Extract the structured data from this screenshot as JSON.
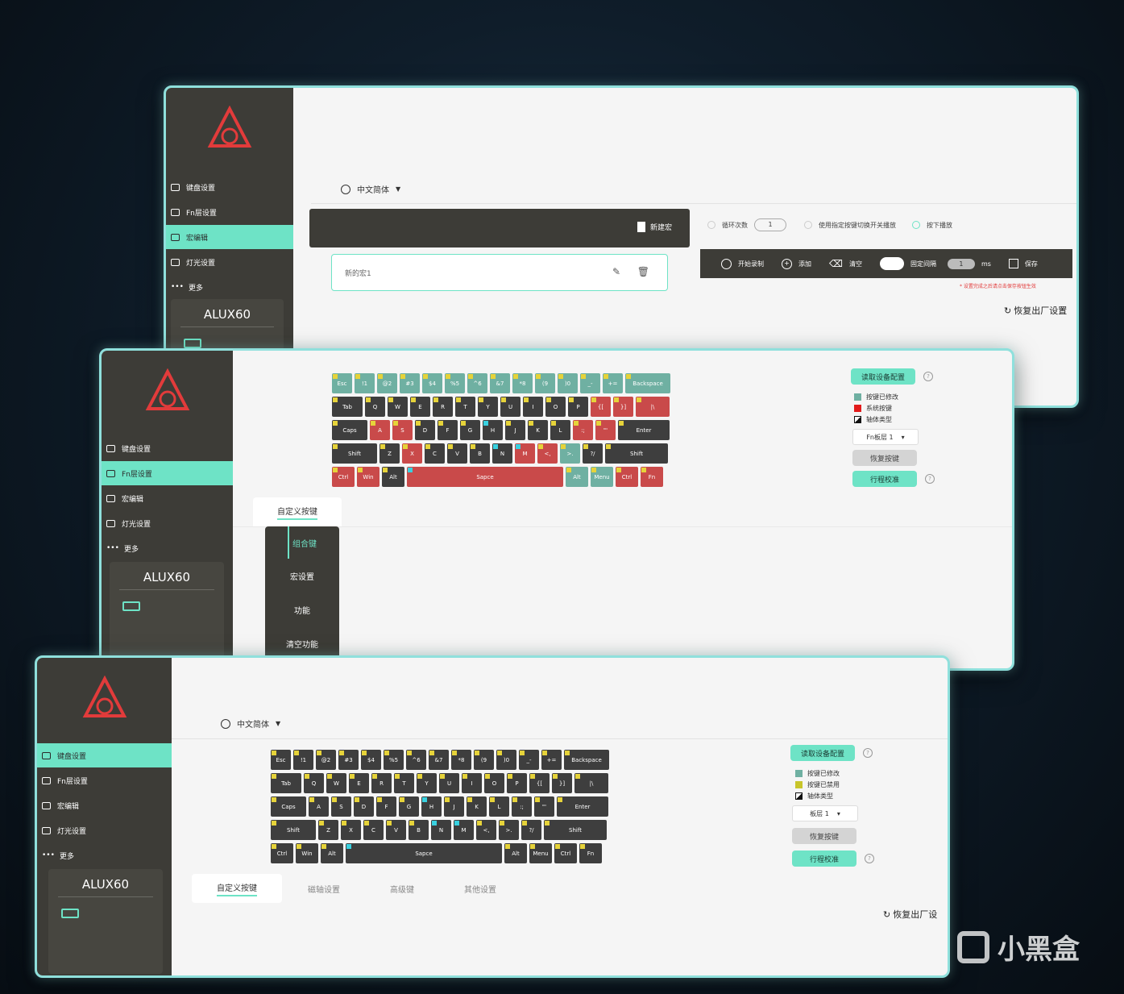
{
  "lang": "中文简体",
  "device": "ALUX60",
  "nav": [
    "键盘设置",
    "Fn层设置",
    "宏编辑",
    "灯光设置",
    "更多"
  ],
  "macro": {
    "new_label": "新建宏",
    "item": "新的宏1",
    "loop_label": "循环次数",
    "loop_value": "1",
    "toggle_label": "使用指定按键切换开关播放",
    "press_label": "按下播放",
    "record": "开始录制",
    "add": "添加",
    "clear": "清空",
    "fixed_interval": "固定间隔",
    "interval_value": "1",
    "ms": "ms",
    "save": "保存",
    "warning": "* 设置完成之后请点击保存按钮生效",
    "restore": "恢复出厂设置"
  },
  "right_panel": {
    "read_config": "读取设备配置",
    "legend_modified": "按键已修改",
    "legend_system": "系统按键",
    "legend_axis": "轴体类型",
    "legend_used": "按键已禁用",
    "fn_select": "Fn板层 1",
    "layer_select": "板层 1",
    "restore_keys": "恢复按键",
    "travel_calib": "行程校准"
  },
  "tabs2": {
    "custom": "自定义按键",
    "combo": "组合键",
    "macro_set": "宏设置",
    "function": "功能",
    "clear_function": "清空功能"
  },
  "tabs3": [
    "自定义按键",
    "磁轴设置",
    "高级键",
    "其他设置"
  ],
  "restore_short": "恢复出厂设",
  "watermark": "小黑盒",
  "colors": {
    "teal": "#6ee3c6",
    "red": "#c94a4a",
    "greenkey": "#6fb0a2",
    "dark": "#3e3e3e",
    "accent": "#e23b3b"
  },
  "keyboard": [
    [
      "Esc",
      "!1",
      "@2",
      "#3",
      "$4",
      "%5",
      "^6",
      "&7",
      "*8",
      "(9",
      ")0",
      "_-",
      "+=",
      "Backspace"
    ],
    [
      "Tab",
      "Q",
      "W",
      "E",
      "R",
      "T",
      "Y",
      "U",
      "I",
      "O",
      "P",
      "{[",
      "}]",
      "|\\"
    ],
    [
      "Caps",
      "A",
      "S",
      "D",
      "F",
      "G",
      "H",
      "J",
      "K",
      "L",
      ":;",
      "\"'",
      "Enter"
    ],
    [
      "Shift",
      "Z",
      "X",
      "C",
      "V",
      "B",
      "N",
      "M",
      "<,",
      ">.",
      "?/",
      "Shift"
    ],
    [
      "Ctrl",
      "Win",
      "Alt",
      "Sapce",
      "Alt",
      "Menu",
      "Ctrl",
      "Fn"
    ]
  ]
}
